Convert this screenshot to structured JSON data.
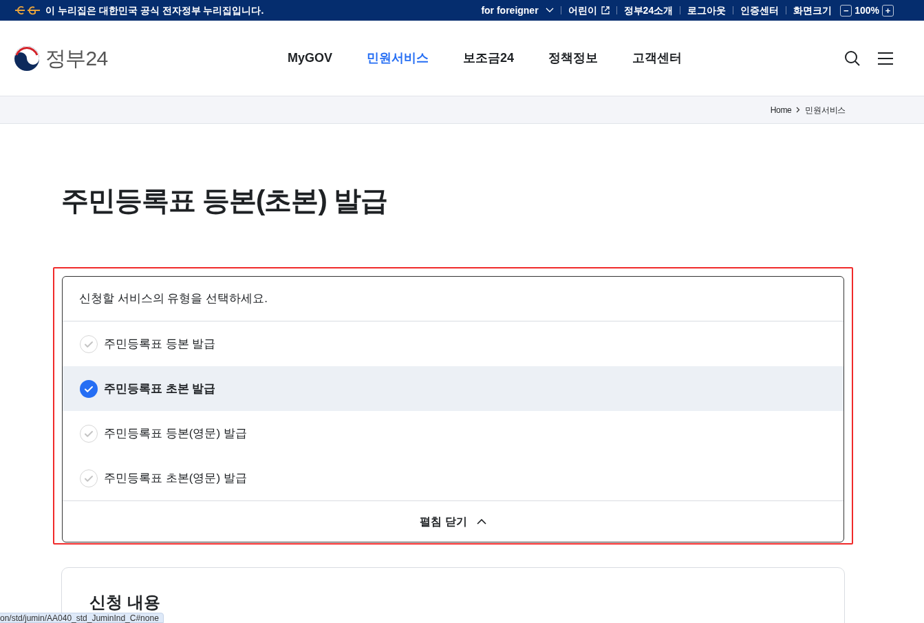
{
  "top_bar": {
    "notice": "이 누리집은 대한민국 공식 전자정부 누리집입니다.",
    "links": [
      {
        "label": "for foreigner",
        "kind": "dropdown"
      },
      {
        "label": "어린이",
        "kind": "external"
      },
      {
        "label": "정부24소개",
        "kind": "plain"
      },
      {
        "label": "로그아웃",
        "kind": "plain"
      },
      {
        "label": "인증센터",
        "kind": "plain"
      },
      {
        "label": "화면크기",
        "kind": "plain"
      }
    ],
    "zoom": {
      "minus": "−",
      "value": "100%",
      "plus": "+"
    }
  },
  "header": {
    "logo": "정부24",
    "nav": [
      {
        "label": "MyGOV",
        "selected": false
      },
      {
        "label": "민원서비스",
        "selected": true
      },
      {
        "label": "보조금24",
        "selected": false
      },
      {
        "label": "정책정보",
        "selected": false
      },
      {
        "label": "고객센터",
        "selected": false
      }
    ]
  },
  "breadcrumb": [
    "Home",
    "민원서비스"
  ],
  "page_title": "주민등록표 등본(초본) 발급",
  "service_type": {
    "prompt": "신청할 서비스의 유형을 선택하세요.",
    "options": [
      {
        "label": "주민등록표 등본 발급",
        "selected": false
      },
      {
        "label": "주민등록표 초본 발급",
        "selected": true
      },
      {
        "label": "주민등록표 등본(영문) 발급",
        "selected": false
      },
      {
        "label": "주민등록표 초본(영문) 발급",
        "selected": false
      }
    ],
    "toggle": "펼침 닫기",
    "expanded": true
  },
  "application": {
    "heading": "신청 내용"
  },
  "status_url": "on/std/jumin/AA040_std_JuminInd_C#none"
}
